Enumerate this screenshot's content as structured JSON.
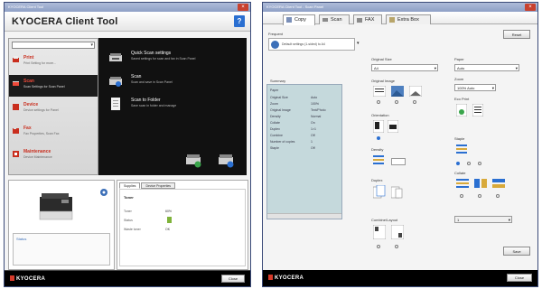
{
  "window1": {
    "title": "KYOCERA Client Tool",
    "app_title": "KYOCERA Client Tool",
    "help": "?",
    "close": "×",
    "device_select": "",
    "nav": [
      {
        "label": "Print",
        "desc": "Print Setting for more..."
      },
      {
        "label": "Scan",
        "desc": "Scan Settings for Scan Panel"
      },
      {
        "label": "Device",
        "desc": "Device settings for Panel"
      },
      {
        "label": "Fax",
        "desc": "Fax Properties, Scan Fax"
      },
      {
        "label": "Maintenance",
        "desc": "Device Maintenance"
      }
    ],
    "actions": [
      {
        "title": "Quick Scan settings",
        "desc": "Saved settings for scan and fax in Scan Panel"
      },
      {
        "title": "Scan",
        "desc": "Scan and save in Scan Panel"
      },
      {
        "title": "Scan to Folder",
        "desc": "Save scan in folder and manage"
      }
    ],
    "status_label": "Status",
    "supplies_tabs": [
      "Supplies",
      "Device Properties"
    ],
    "supplies_head": "Toner",
    "supplies_rows": [
      {
        "label": "Toner",
        "value": "60%"
      },
      {
        "label": "Status",
        "value": "OK"
      },
      {
        "label": "Waste toner",
        "value": "OK"
      }
    ],
    "brand": "KYOCERA",
    "close_button": "Close"
  },
  "window2": {
    "title": "KYOCERA Client Tool - Scan Panel",
    "close": "×",
    "tabs": [
      "Copy",
      "Scan",
      "FAX",
      "Extra Box"
    ],
    "profile_label": "Frequent",
    "profile_text": "Default settings (1-sided) to A4",
    "reset": "Reset",
    "summary_label": "Summary",
    "summary": [
      {
        "label": "Paper",
        "value": ""
      },
      {
        "label": "Original Size",
        "value": "Auto"
      },
      {
        "label": "Zoom",
        "value": "100%"
      },
      {
        "label": "Original Image",
        "value": "Text/Photo"
      },
      {
        "label": "Density",
        "value": "Normal"
      },
      {
        "label": "Collate",
        "value": "On"
      },
      {
        "label": "Duplex",
        "value": "1>1"
      },
      {
        "label": "Combine",
        "value": "Off"
      },
      {
        "label": "Number of copies",
        "value": "1"
      },
      {
        "label": "Staple",
        "value": "Off"
      }
    ],
    "colA_labels": [
      "Original Size",
      "Original Image",
      "Orientation",
      "Density",
      "Duplex",
      "Combine/Layout"
    ],
    "colA_select": "A4",
    "colB_labels": [
      "Paper",
      "Zoom",
      "Eco Print",
      "Staple",
      "Collate"
    ],
    "colB_paper": "Auto",
    "colB_zoom": "100% Auto",
    "copies_value": "1",
    "save_button": "Save",
    "brand": "KYOCERA",
    "ok_button": "Close"
  },
  "colors": {
    "accent_red": "#c92e1e",
    "brand_blue": "#2a6fd1",
    "panel_dark": "#111111",
    "summary_bg": "#c5d9dc"
  }
}
